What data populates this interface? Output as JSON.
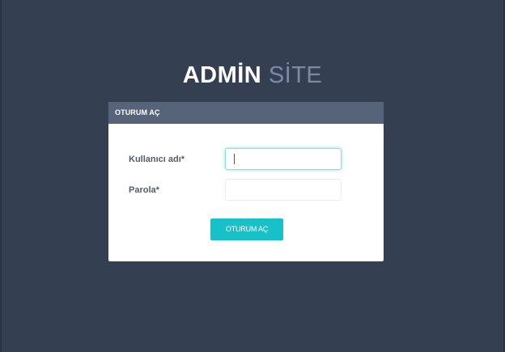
{
  "brand": {
    "title_strong": "ADMİN",
    "title_light": "SİTE"
  },
  "login_panel": {
    "header": "OTURUM AÇ",
    "username_label": "Kullanıcı adı*",
    "username_value": "",
    "password_label": "Parola*",
    "password_value": "",
    "submit_label": "OTURUM AÇ"
  },
  "colors": {
    "background": "#353f52",
    "panel_header": "#566379",
    "accent": "#18c0c8",
    "title_light": "#7d8aa3"
  }
}
